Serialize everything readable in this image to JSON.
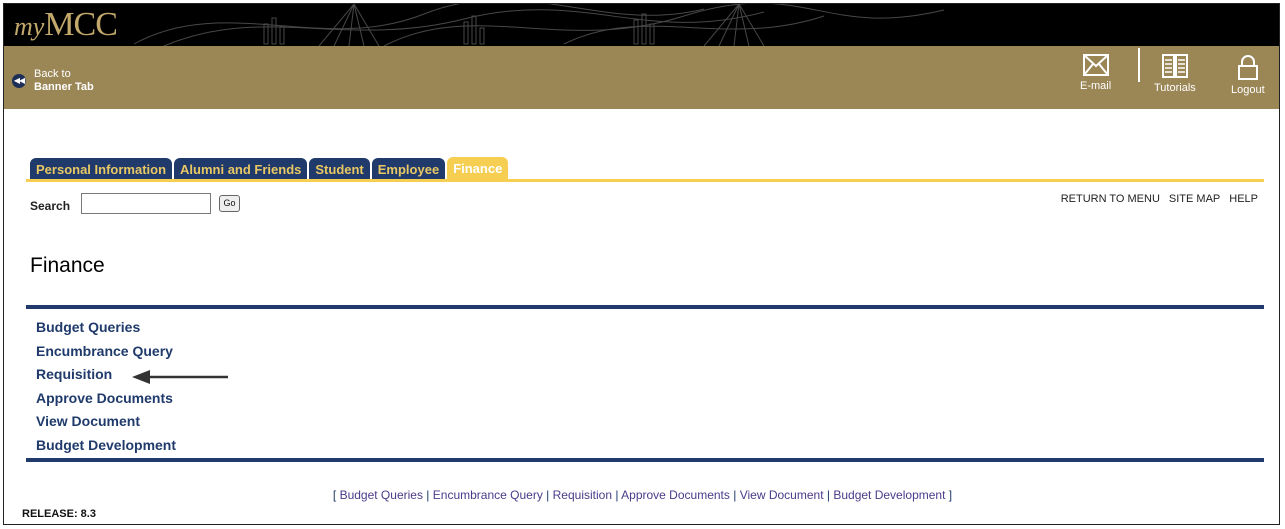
{
  "banner": {
    "logo_my": "my",
    "logo_mcc": "MCC"
  },
  "toolbar": {
    "back_line1": "Back to",
    "back_line2": "Banner Tab",
    "email_label": "E-mail",
    "tutorials_label": "Tutorials",
    "logout_label": "Logout"
  },
  "tabs": [
    {
      "label": "Personal Information",
      "active": false
    },
    {
      "label": "Alumni and Friends",
      "active": false
    },
    {
      "label": "Student",
      "active": false
    },
    {
      "label": "Employee",
      "active": false
    },
    {
      "label": "Finance",
      "active": true
    }
  ],
  "search": {
    "label": "Search",
    "value": "",
    "go_label": "Go"
  },
  "util_links": {
    "return_to_menu": "RETURN TO MENU",
    "site_map": "SITE MAP",
    "help": "HELP"
  },
  "page": {
    "title": "Finance"
  },
  "menu": {
    "items": [
      "Budget Queries",
      "Encumbrance Query",
      "Requisition",
      "Approve Documents",
      "View Document",
      "Budget Development"
    ]
  },
  "footer": {
    "open": "[",
    "close": "]",
    "separator": "|",
    "links": [
      "Budget Queries",
      "Encumbrance Query",
      "Requisition",
      "Approve Documents",
      "View Document",
      "Budget Development"
    ],
    "release": "RELEASE: 8.3"
  },
  "colors": {
    "navy": "#1f3a6b",
    "gold": "#f6cf52",
    "toolbar": "#9b8656",
    "banner": "#000000"
  },
  "icons": {
    "email": "envelope-icon",
    "tutorials": "book-icon",
    "logout": "padlock-icon",
    "back": "rewind-icon",
    "annotation": "arrow-left-icon"
  }
}
